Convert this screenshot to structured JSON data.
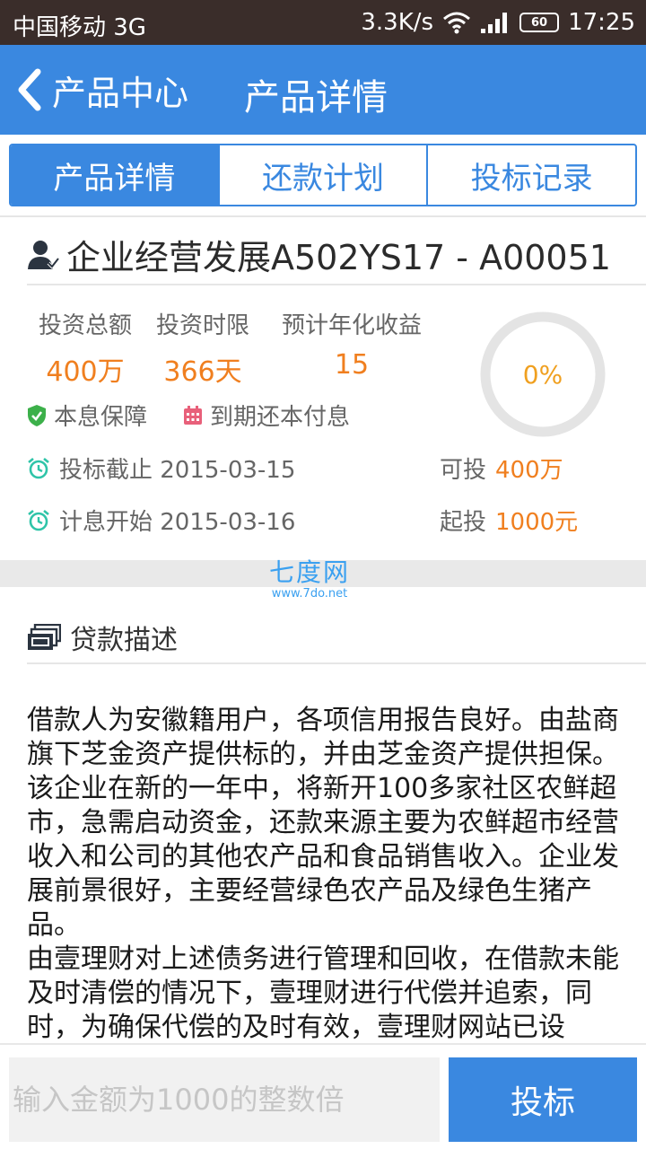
{
  "status_bar": {
    "carrier": "中国移动 3G",
    "speed": "3.3K/s",
    "battery": "60",
    "time": "17:25",
    "icons": [
      "wifi-icon",
      "signal-icon",
      "battery-icon"
    ]
  },
  "nav": {
    "back_label": "产品中心",
    "title": "产品详情"
  },
  "tabs": [
    {
      "label": "产品详情",
      "active": true
    },
    {
      "label": "还款计划",
      "active": false
    },
    {
      "label": "投标记录",
      "active": false
    }
  ],
  "product": {
    "title": "企业经营发展A502YS17 - A00051",
    "metrics": [
      {
        "label": "投资总额",
        "value": "400万"
      },
      {
        "label": "投资时限",
        "value": "366天"
      },
      {
        "label": "预计年化收益",
        "value": "15"
      }
    ],
    "features": [
      {
        "label": "本息保障",
        "icon": "shield-check-icon"
      },
      {
        "label": "到期还本付息",
        "icon": "calendar-icon"
      }
    ],
    "dates": [
      {
        "label": "投标截止 2015-03-15",
        "icon": "alarm-clock-icon"
      },
      {
        "label": "计息开始 2015-03-16",
        "icon": "alarm-clock-icon"
      }
    ],
    "available": {
      "label": "可投",
      "value": "400万"
    },
    "minimum": {
      "label": "起投",
      "value": "1000元"
    },
    "progress": {
      "text": "0%",
      "fraction": 0
    }
  },
  "watermark": {
    "line1": "七度网",
    "line2": "www.7do.net"
  },
  "description": {
    "title": "贷款描述",
    "body": "借款人为安徽籍用户，各项信用报告良好。由盐商旗下芝金资产提供标的，并由芝金资产提供担保。该企业在新的一年中，将新开100多家社区农鲜超市，急需启动资金，还款来源主要为农鲜超市经营收入和公司的其他农产品和食品销售收入。企业发展前景很好，主要经营绿色农产品及绿色生猪产品。\n由壹理财对上述债务进行管理和回收，在借款未能及时清偿的情况下，壹理财进行代偿并追索，同时，为确保代偿的及时有效，壹理财网站已设"
  },
  "bottom": {
    "input_placeholder": "输入金额为1000的整数倍",
    "button_label": "投标"
  },
  "colors": {
    "primary": "#3a88e0",
    "accent": "#f07f1f",
    "status_bar": "#3a2d2a",
    "progress_text": "#f0a020"
  }
}
